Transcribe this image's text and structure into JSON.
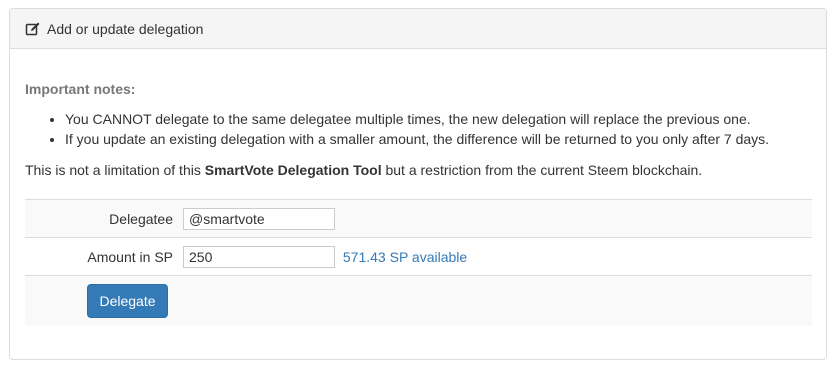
{
  "panel": {
    "title": "Add or update delegation",
    "title_icon": "edit-icon"
  },
  "notes": {
    "title": "Important notes:",
    "items": [
      "You CANNOT delegate to the same delegatee multiple times, the new delegation will replace the previous one.",
      "If you update an existing delegation with a smaller amount, the difference will be returned to you only after 7 days."
    ]
  },
  "disclaimer": {
    "prefix": "This is not a limitation of this ",
    "tool_name": "SmartVote Delegation Tool",
    "suffix": " but a restriction from the current Steem blockchain."
  },
  "form": {
    "delegatee_label": "Delegatee",
    "delegatee_value": "@smartvote",
    "amount_label": "Amount in SP",
    "amount_value": "250",
    "available_text": "571.43 SP available",
    "submit_label": "Delegate"
  },
  "colors": {
    "primary": "#337ab7",
    "heading_bg": "#f5f5f5",
    "row_stripe": "#f9f9f9"
  }
}
